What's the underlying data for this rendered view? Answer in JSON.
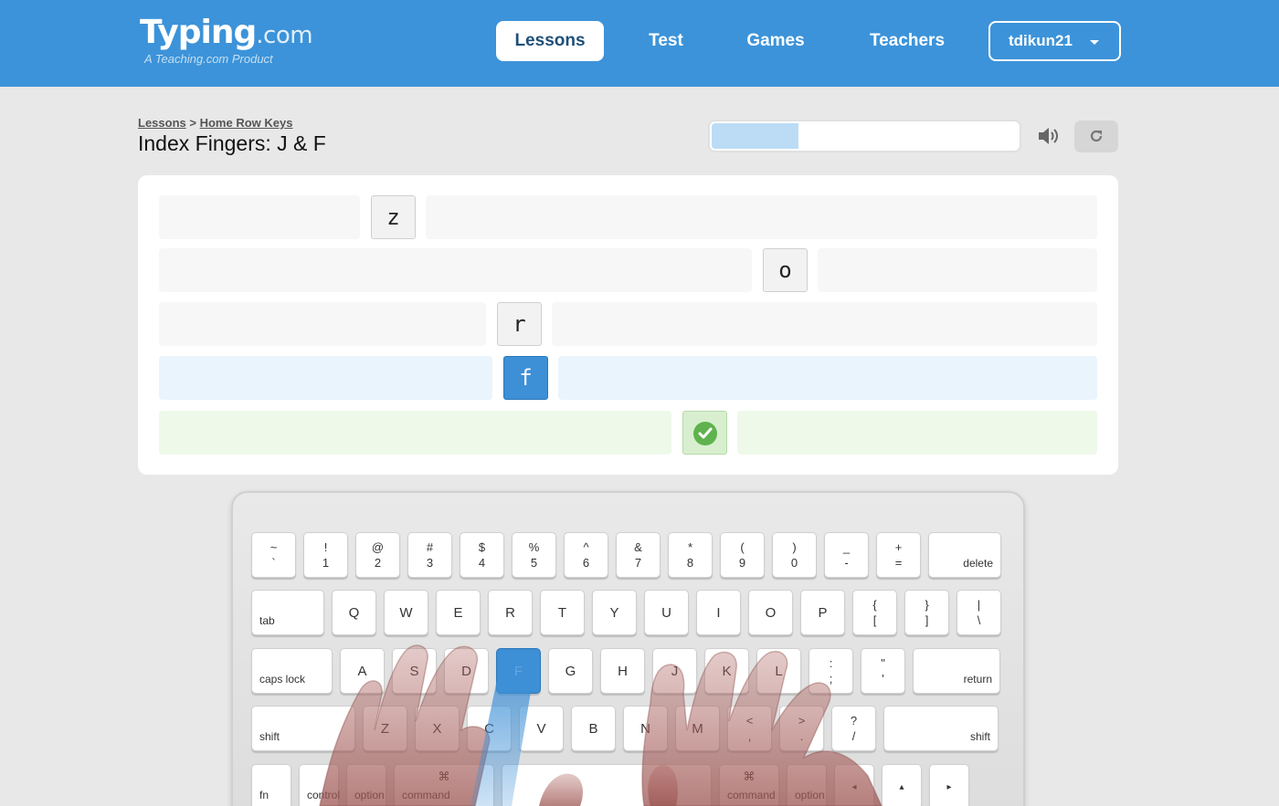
{
  "header": {
    "logo_main": "Typing",
    "logo_com": ".com",
    "logo_sub": "A Teaching.com Product",
    "nav": {
      "lessons": "Lessons",
      "test": "Test",
      "games": "Games",
      "teachers": "Teachers"
    },
    "user": "tdikun21"
  },
  "breadcrumb": {
    "root": "Lessons",
    "separator": ">",
    "current": "Home Row Keys"
  },
  "title": "Index Fingers: J & F",
  "progress": {
    "value": 0.28,
    "color": "#bcdcf5"
  },
  "toolbar": {
    "sound_icon": "speaker-icon",
    "restart_icon": "restart-icon"
  },
  "lesson": {
    "rows": [
      {
        "char": "z",
        "state": "upcoming"
      },
      {
        "char": "o",
        "state": "upcoming"
      },
      {
        "char": "r",
        "state": "upcoming"
      },
      {
        "char": "f",
        "state": "current"
      },
      {
        "char": "",
        "state": "complete",
        "icon": "checkmark-icon"
      }
    ]
  },
  "keyboard": {
    "row1": [
      {
        "top": "~",
        "bot": "`"
      },
      {
        "top": "!",
        "bot": "1"
      },
      {
        "top": "@",
        "bot": "2"
      },
      {
        "top": "#",
        "bot": "3"
      },
      {
        "top": "$",
        "bot": "4"
      },
      {
        "top": "%",
        "bot": "5"
      },
      {
        "top": "^",
        "bot": "6"
      },
      {
        "top": "&",
        "bot": "7"
      },
      {
        "top": "*",
        "bot": "8"
      },
      {
        "top": "(",
        "bot": "9"
      },
      {
        "top": ")",
        "bot": "0"
      },
      {
        "top": "_",
        "bot": "-"
      },
      {
        "top": "+",
        "bot": "="
      },
      {
        "label": "delete"
      }
    ],
    "row2": [
      {
        "label": "tab"
      },
      {
        "single": "Q"
      },
      {
        "single": "W"
      },
      {
        "single": "E"
      },
      {
        "single": "R"
      },
      {
        "single": "T"
      },
      {
        "single": "Y"
      },
      {
        "single": "U"
      },
      {
        "single": "I"
      },
      {
        "single": "O"
      },
      {
        "single": "P"
      },
      {
        "top": "{",
        "bot": "["
      },
      {
        "top": "}",
        "bot": "]"
      },
      {
        "top": "|",
        "bot": "\\"
      }
    ],
    "row3": [
      {
        "label": "caps lock"
      },
      {
        "single": "A"
      },
      {
        "single": "S"
      },
      {
        "single": "D"
      },
      {
        "single": "F",
        "active": true
      },
      {
        "single": "G"
      },
      {
        "single": "H"
      },
      {
        "single": "J"
      },
      {
        "single": "K"
      },
      {
        "single": "L"
      },
      {
        "top": ":",
        "bot": ";"
      },
      {
        "top": "\"",
        "bot": "'"
      },
      {
        "label": "return"
      }
    ],
    "row4": [
      {
        "label": "shift"
      },
      {
        "single": "Z"
      },
      {
        "single": "X"
      },
      {
        "single": "C"
      },
      {
        "single": "V"
      },
      {
        "single": "B"
      },
      {
        "single": "N"
      },
      {
        "single": "M"
      },
      {
        "top": "<",
        "bot": ","
      },
      {
        "top": ">",
        "bot": "."
      },
      {
        "top": "?",
        "bot": "/"
      },
      {
        "label": "shift"
      }
    ],
    "row5": [
      {
        "label": "fn"
      },
      {
        "label": "control"
      },
      {
        "label": "option"
      },
      {
        "label": "command",
        "sym": "⌘"
      },
      {
        "label": ""
      },
      {
        "label": "command",
        "sym": "⌘"
      },
      {
        "label": "option"
      },
      {
        "arrow": "◂"
      },
      {
        "arrow": "▴"
      },
      {
        "arrow": "▸"
      }
    ],
    "active_color": "#3d8fd6"
  }
}
